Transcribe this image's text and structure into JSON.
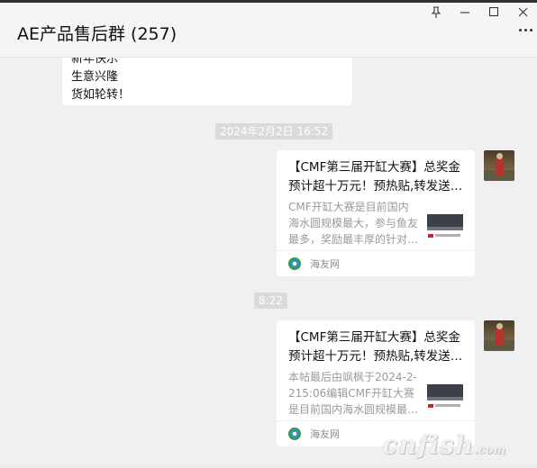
{
  "window": {
    "title": "AE产品售后群 (257)",
    "controls": {
      "pin": "📌",
      "minimize": "—",
      "maximize": "☐",
      "close": "✕"
    }
  },
  "messages": {
    "greeting": {
      "lines": [
        "新年快乐",
        "生意兴隆",
        "货如轮转！"
      ]
    },
    "time1": "2024年2月2日 16:52",
    "card1": {
      "title_lines": [
        "【CMF第三届开缸大赛】总奖金",
        "预计超十万元！预热贴,转发送…"
      ],
      "desc_lines": [
        "CMF开缸大赛是目前国内",
        "海水圆规模最大，参与鱼友",
        "最多，奖励最丰厚的针对…"
      ],
      "source": "海友网"
    },
    "time2": "8:22",
    "card2": {
      "title_lines": [
        "【CMF第三届开缸大赛】总奖金",
        "预计超十万元！预热贴,转发送…"
      ],
      "desc_lines": [
        "本帖最后由飒枫于2024-2-",
        "215:06编辑CMF开缸大赛",
        "是目前国内海水圆规模最…"
      ],
      "source": "海友网"
    }
  },
  "watermark": {
    "main": "cnfish",
    "suffix": ".com"
  },
  "colors": {
    "background": "#f0f0f0",
    "bubble": "#ffffff",
    "timestamp": "#dadada",
    "muted_text": "#9a9a9a"
  }
}
